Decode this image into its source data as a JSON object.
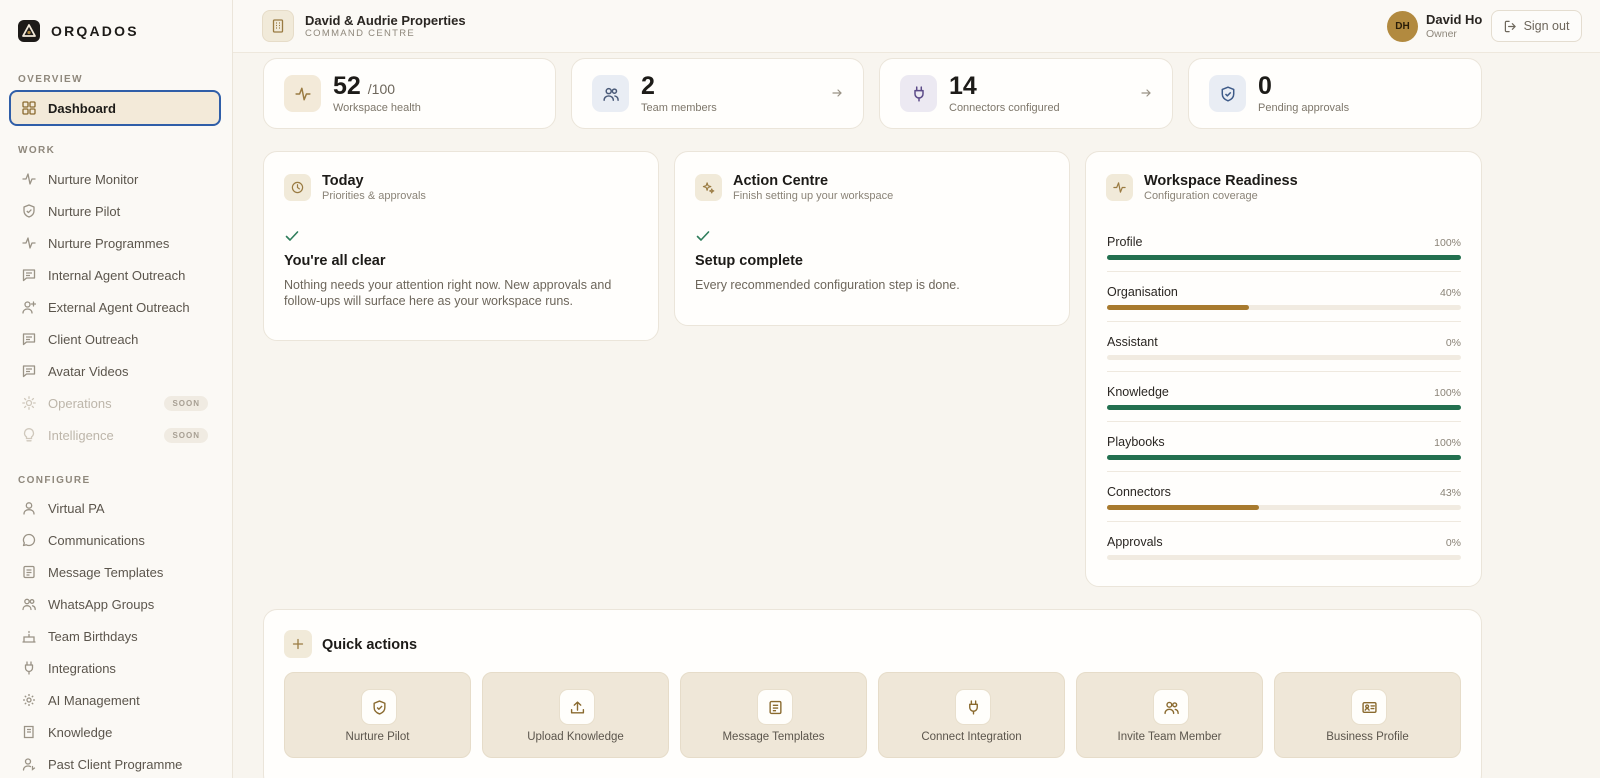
{
  "brand": {
    "name": "ORQADOS"
  },
  "sidebar": {
    "sections": {
      "overview": "OVERVIEW",
      "work": "WORK",
      "configure": "CONFIGURE"
    },
    "items": [
      {
        "label": "Dashboard",
        "icon": "dashboard-grid-icon",
        "active": true
      },
      {
        "label": "Nurture Monitor",
        "icon": "activity-icon"
      },
      {
        "label": "Nurture Pilot",
        "icon": "shield-check-icon"
      },
      {
        "label": "Nurture Programmes",
        "icon": "activity-icon"
      },
      {
        "label": "Internal Agent Outreach",
        "icon": "message-square-icon"
      },
      {
        "label": "External Agent Outreach",
        "icon": "user-plus-icon"
      },
      {
        "label": "Client Outreach",
        "icon": "message-square-icon"
      },
      {
        "label": "Avatar Videos",
        "icon": "message-square-icon"
      },
      {
        "label": "Operations",
        "icon": "sun-icon",
        "badge": "SOON",
        "disabled": true
      },
      {
        "label": "Intelligence",
        "icon": "lightbulb-icon",
        "badge": "SOON",
        "disabled": true
      },
      {
        "label": "Virtual PA",
        "icon": "user-icon"
      },
      {
        "label": "Communications",
        "icon": "chat-bubble-icon"
      },
      {
        "label": "Message Templates",
        "icon": "file-text-icon"
      },
      {
        "label": "WhatsApp Groups",
        "icon": "users-icon"
      },
      {
        "label": "Team Birthdays",
        "icon": "cake-icon"
      },
      {
        "label": "Integrations",
        "icon": "plug-icon"
      },
      {
        "label": "AI Management",
        "icon": "gear-icon"
      },
      {
        "label": "Knowledge",
        "icon": "book-icon"
      },
      {
        "label": "Past Client Programme",
        "icon": "user-refresh-icon"
      }
    ]
  },
  "header": {
    "org_name": "David & Audrie Properties",
    "org_sub": "COMMAND CENTRE",
    "user_initials": "DH",
    "user_name": "David Ho",
    "user_role": "Owner",
    "signout_label": "Sign out"
  },
  "stats": [
    {
      "value": "52",
      "suffix": "/100",
      "label": "Workspace health",
      "icon": "activity-icon",
      "icon_bg": "#f3ead9",
      "icon_color": "#9a7b42"
    },
    {
      "value": "2",
      "label": "Team members",
      "icon": "users-icon",
      "icon_bg": "#e9edf4",
      "icon_color": "#4a5a78",
      "arrow": true
    },
    {
      "value": "14",
      "label": "Connectors configured",
      "icon": "plug-icon",
      "icon_bg": "#ece9f2",
      "icon_color": "#5b4a88",
      "arrow": true
    },
    {
      "value": "0",
      "label": "Pending approvals",
      "icon": "shield-check-icon",
      "icon_bg": "#e9edf4",
      "icon_color": "#3d5a88"
    }
  ],
  "today": {
    "title": "Today",
    "subtitle": "Priorities & approvals",
    "status_title": "You're all clear",
    "status_desc": "Nothing needs your attention right now. New approvals and follow-ups will surface here as your workspace runs."
  },
  "action_centre": {
    "title": "Action Centre",
    "subtitle": "Finish setting up your workspace",
    "status_title": "Setup complete",
    "status_desc": "Every recommended configuration step is done."
  },
  "readiness": {
    "title": "Workspace Readiness",
    "subtitle": "Configuration coverage",
    "rows": [
      {
        "name": "Profile",
        "pct_label": "100%",
        "pct": 100,
        "color": "#23704f"
      },
      {
        "name": "Organisation",
        "pct_label": "40%",
        "pct": 40,
        "color": "#a87a2e"
      },
      {
        "name": "Assistant",
        "pct_label": "0%",
        "pct": 0,
        "color": "#a87a2e"
      },
      {
        "name": "Knowledge",
        "pct_label": "100%",
        "pct": 100,
        "color": "#23704f"
      },
      {
        "name": "Playbooks",
        "pct_label": "100%",
        "pct": 100,
        "color": "#23704f"
      },
      {
        "name": "Connectors",
        "pct_label": "43%",
        "pct": 43,
        "color": "#a87a2e"
      },
      {
        "name": "Approvals",
        "pct_label": "0%",
        "pct": 0,
        "color": "#a87a2e"
      }
    ]
  },
  "quick_actions": {
    "title": "Quick actions",
    "items": [
      {
        "label": "Nurture Pilot",
        "icon": "shield-check-icon"
      },
      {
        "label": "Upload Knowledge",
        "icon": "upload-icon"
      },
      {
        "label": "Message Templates",
        "icon": "file-text-icon"
      },
      {
        "label": "Connect Integration",
        "icon": "plug-icon"
      },
      {
        "label": "Invite Team Member",
        "icon": "users-icon"
      },
      {
        "label": "Business Profile",
        "icon": "id-card-icon"
      }
    ]
  }
}
